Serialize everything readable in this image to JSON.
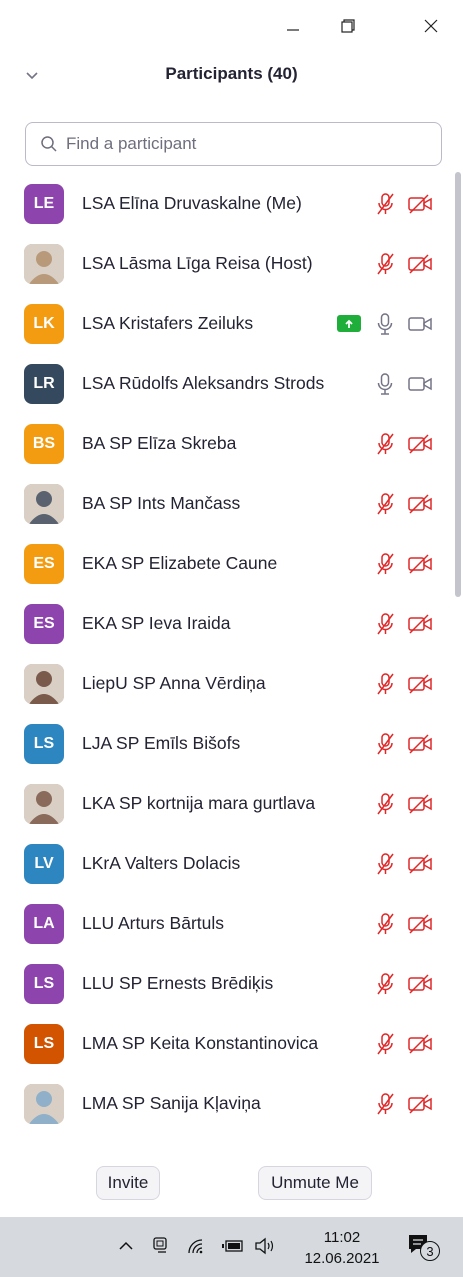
{
  "window": {
    "controls": [
      "minimize",
      "maximize",
      "close"
    ]
  },
  "panel": {
    "title": "Participants (40)"
  },
  "search": {
    "placeholder": "Find a participant",
    "value": ""
  },
  "participants": [
    {
      "name": "LSA Elīna Druvaskalne (Me)",
      "initials": "LE",
      "color": "#8e44ad",
      "photo": false,
      "mic": "muted",
      "video": "off",
      "sharing": false
    },
    {
      "name": "LSA Lāsma Līga Reisa (Host)",
      "initials": "",
      "color": "#b89a7a",
      "photo": true,
      "mic": "muted",
      "video": "off",
      "sharing": false
    },
    {
      "name": "LSA Kristafers Zeiluks",
      "initials": "LK",
      "color": "#f39c12",
      "photo": false,
      "mic": "on",
      "video": "on",
      "sharing": true
    },
    {
      "name": "LSA Rūdolfs Aleksandrs Strods",
      "initials": "LR",
      "color": "#34495e",
      "photo": false,
      "mic": "on",
      "video": "on",
      "sharing": false
    },
    {
      "name": "BA SP Elīza Skreba",
      "initials": "BS",
      "color": "#f39c12",
      "photo": false,
      "mic": "muted",
      "video": "off",
      "sharing": false
    },
    {
      "name": "BA SP Ints Mančass",
      "initials": "",
      "color": "#5a6270",
      "photo": true,
      "mic": "muted",
      "video": "off",
      "sharing": false
    },
    {
      "name": "EKA SP Elizabete Caune",
      "initials": "ES",
      "color": "#f39c12",
      "photo": false,
      "mic": "muted",
      "video": "off",
      "sharing": false
    },
    {
      "name": "EKA SP Ieva Iraida",
      "initials": "ES",
      "color": "#8e44ad",
      "photo": false,
      "mic": "muted",
      "video": "off",
      "sharing": false
    },
    {
      "name": "LiepU SP Anna Vērdiņa",
      "initials": "",
      "color": "#7a5a4a",
      "photo": true,
      "mic": "muted",
      "video": "off",
      "sharing": false
    },
    {
      "name": "LJA SP Emīls Bišofs",
      "initials": "LS",
      "color": "#2e86c1",
      "photo": false,
      "mic": "muted",
      "video": "off",
      "sharing": false
    },
    {
      "name": "LKA SP kortnija mara gurtlava",
      "initials": "",
      "color": "#8a6a5a",
      "photo": true,
      "mic": "muted",
      "video": "off",
      "sharing": false
    },
    {
      "name": "LKrA Valters Dolacis",
      "initials": "LV",
      "color": "#2e86c1",
      "photo": false,
      "mic": "muted",
      "video": "off",
      "sharing": false
    },
    {
      "name": "LLU Arturs Bārtuls",
      "initials": "LA",
      "color": "#8e44ad",
      "photo": false,
      "mic": "muted",
      "video": "off",
      "sharing": false
    },
    {
      "name": "LLU SP Ernests Brēdiķis",
      "initials": "LS",
      "color": "#8e44ad",
      "photo": false,
      "mic": "muted",
      "video": "off",
      "sharing": false
    },
    {
      "name": "LMA SP Keita Konstantinovica",
      "initials": "LS",
      "color": "#d35400",
      "photo": false,
      "mic": "muted",
      "video": "off",
      "sharing": false
    },
    {
      "name": "LMA SP Sanija Kļaviņa",
      "initials": "",
      "color": "#8fb0c8",
      "photo": true,
      "mic": "muted",
      "video": "off",
      "sharing": false
    }
  ],
  "footer": {
    "invite_label": "Invite",
    "unmute_label": "Unmute Me"
  },
  "taskbar": {
    "time": "11:02",
    "date": "12.06.2021",
    "notification_count": "3"
  },
  "colors": {
    "muted_red": "#e02828",
    "share_green": "#1fae3a",
    "icon_gray": "#747487"
  }
}
